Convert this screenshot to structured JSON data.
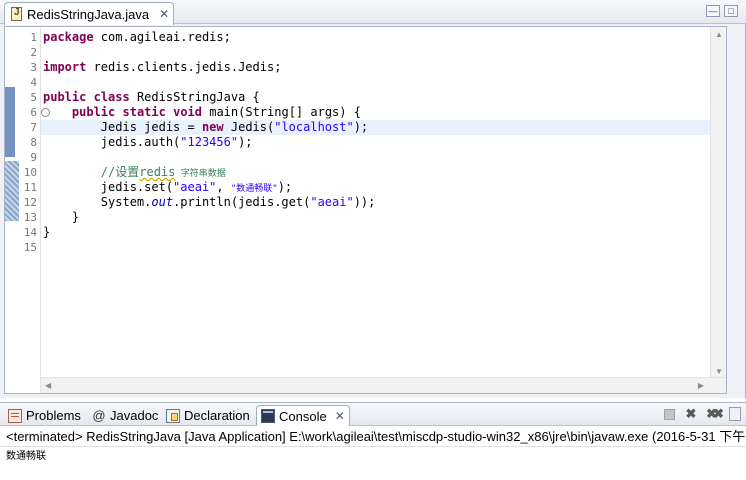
{
  "editor": {
    "tab_label": "RedisStringJava.java",
    "tab_close": "✕",
    "minimize": "—",
    "maximize": "□",
    "lines": [
      {
        "num": "1",
        "segs": [
          {
            "t": "package",
            "c": "kw"
          },
          {
            "t": " com.agileai.redis;",
            "c": ""
          }
        ]
      },
      {
        "num": "2",
        "segs": []
      },
      {
        "num": "3",
        "segs": [
          {
            "t": "import",
            "c": "kw"
          },
          {
            "t": " redis.clients.jedis.Jedis;",
            "c": ""
          }
        ]
      },
      {
        "num": "4",
        "segs": []
      },
      {
        "num": "5",
        "segs": [
          {
            "t": "public",
            "c": "kw"
          },
          {
            "t": " ",
            "c": ""
          },
          {
            "t": "class",
            "c": "kw"
          },
          {
            "t": " RedisStringJava {",
            "c": ""
          }
        ]
      },
      {
        "num": "6",
        "fold": "⊖",
        "segs": [
          {
            "t": "    ",
            "c": ""
          },
          {
            "t": "public",
            "c": "kw"
          },
          {
            "t": " ",
            "c": ""
          },
          {
            "t": "static",
            "c": "kw"
          },
          {
            "t": " ",
            "c": ""
          },
          {
            "t": "void",
            "c": "kw"
          },
          {
            "t": " main(String[] args) {",
            "c": ""
          }
        ]
      },
      {
        "num": "7",
        "current": true,
        "segs": [
          {
            "t": "        Jedis jedis = ",
            "c": ""
          },
          {
            "t": "new",
            "c": "kw"
          },
          {
            "t": " Jedis(",
            "c": ""
          },
          {
            "t": "\"localhost\"",
            "c": "str"
          },
          {
            "t": ");",
            "c": ""
          }
        ]
      },
      {
        "num": "8",
        "segs": [
          {
            "t": "        jedis.auth(",
            "c": ""
          },
          {
            "t": "\"123456\"",
            "c": "str"
          },
          {
            "t": ");",
            "c": ""
          }
        ]
      },
      {
        "num": "9",
        "segs": []
      },
      {
        "num": "10",
        "segs": [
          {
            "t": "        //设置",
            "c": "cm"
          },
          {
            "t": "redis",
            "c": "cm squiggle"
          },
          {
            "t": " 字符串数据",
            "c": "cm cjk-small"
          }
        ]
      },
      {
        "num": "11",
        "segs": [
          {
            "t": "        jedis.set(",
            "c": ""
          },
          {
            "t": "\"aeai\"",
            "c": "str"
          },
          {
            "t": ", ",
            "c": ""
          },
          {
            "t": "\"数通畅联\"",
            "c": "str cjk-small"
          },
          {
            "t": ");",
            "c": ""
          }
        ]
      },
      {
        "num": "12",
        "segs": [
          {
            "t": "        System.",
            "c": ""
          },
          {
            "t": "out",
            "c": "st"
          },
          {
            "t": ".println(jedis.get(",
            "c": ""
          },
          {
            "t": "\"aeai\"",
            "c": "str"
          },
          {
            "t": "));",
            "c": ""
          }
        ]
      },
      {
        "num": "13",
        "segs": [
          {
            "t": "    }",
            "c": ""
          }
        ]
      },
      {
        "num": "14",
        "segs": [
          {
            "t": "}",
            "c": ""
          }
        ]
      },
      {
        "num": "15",
        "segs": []
      }
    ]
  },
  "console": {
    "tabs": [
      {
        "label": "Problems",
        "icon": "problems-icon"
      },
      {
        "label": "Javadoc",
        "icon": "javadoc-icon",
        "glyph": "@"
      },
      {
        "label": "Declaration",
        "icon": "declaration-icon"
      },
      {
        "label": "Console",
        "icon": "console-icon",
        "active": true,
        "close": "✕"
      }
    ],
    "status": "<terminated> RedisStringJava [Java Application] E:\\work\\agileai\\test\\miscdp-studio-win32_x86\\jre\\bin\\javaw.exe (2016-5-31 下午",
    "output": "数通畅联"
  },
  "colors": {
    "keyword": "#7f0055",
    "string": "#2a00ff",
    "comment": "#3f7f5f",
    "static_field": "#0000c0",
    "current_line": "#e8f2fe"
  }
}
